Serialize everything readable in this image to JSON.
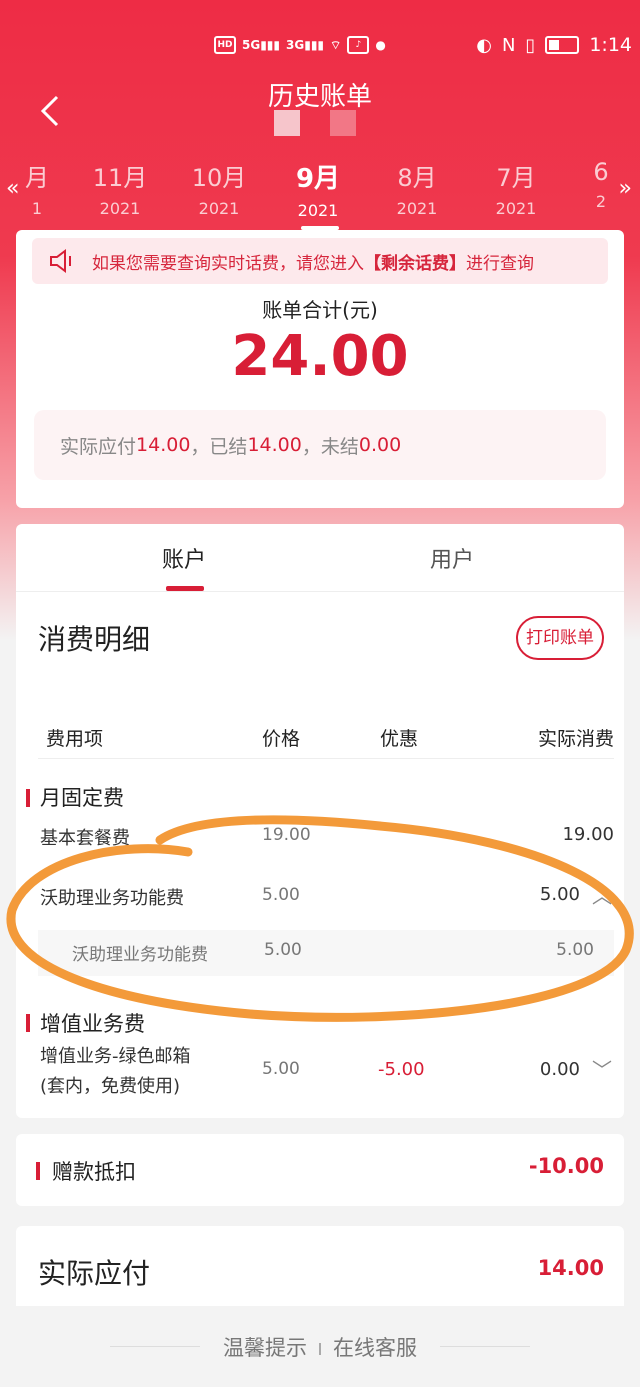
{
  "status": {
    "network1": "5G",
    "network2": "3G",
    "time": "1:14"
  },
  "header": {
    "title": "历史账单"
  },
  "months": [
    {
      "m": "月",
      "y": "1"
    },
    {
      "m": "11月",
      "y": "2021"
    },
    {
      "m": "10月",
      "y": "2021"
    },
    {
      "m": "9月",
      "y": "2021"
    },
    {
      "m": "8月",
      "y": "2021"
    },
    {
      "m": "7月",
      "y": "2021"
    },
    {
      "m": "6",
      "y": "2"
    }
  ],
  "notice": {
    "pre": "如果您需要查询实时话费，请您进入",
    "link": "【剩余话费】",
    "post": "进行查询"
  },
  "summary": {
    "label": "账单合计(元)",
    "amount": "24.00",
    "pay_label": "实际应付",
    "pay_value": "14.00",
    "settled_label": "，已结",
    "settled_value": "14.00",
    "unsettled_label": "，未结",
    "unsettled_value": "0.00"
  },
  "tabs": {
    "account": "账户",
    "user": "用户"
  },
  "detail": {
    "title": "消费明细",
    "print": "打印账单",
    "headers": {
      "item": "费用项",
      "price": "价格",
      "discount": "优惠",
      "actual": "实际消费"
    },
    "groups": {
      "monthly": "月固定费",
      "value_added": "增值业务费"
    },
    "rows": {
      "base": {
        "name": "基本套餐费",
        "price": "19.00",
        "actual": "19.00"
      },
      "wo": {
        "name": "沃助理业务功能费",
        "price": "5.00",
        "actual": "5.00"
      },
      "wo_sub": {
        "name": "沃助理业务功能费",
        "price": "5.00",
        "actual": "5.00"
      },
      "mail": {
        "name1": "增值业务-绿色邮箱",
        "name2": "(套内，免费使用)",
        "price": "5.00",
        "discount": "-5.00",
        "actual": "0.00"
      }
    }
  },
  "gift": {
    "label": "赠款抵扣",
    "value": "-10.00"
  },
  "payable": {
    "label": "实际应付",
    "value": "14.00"
  },
  "footer": {
    "tips": "温馨提示",
    "service": "在线客服"
  },
  "colors": {
    "brand": "#d81e36",
    "hero": "#ee2c45",
    "annotation": "#f39a3a"
  }
}
